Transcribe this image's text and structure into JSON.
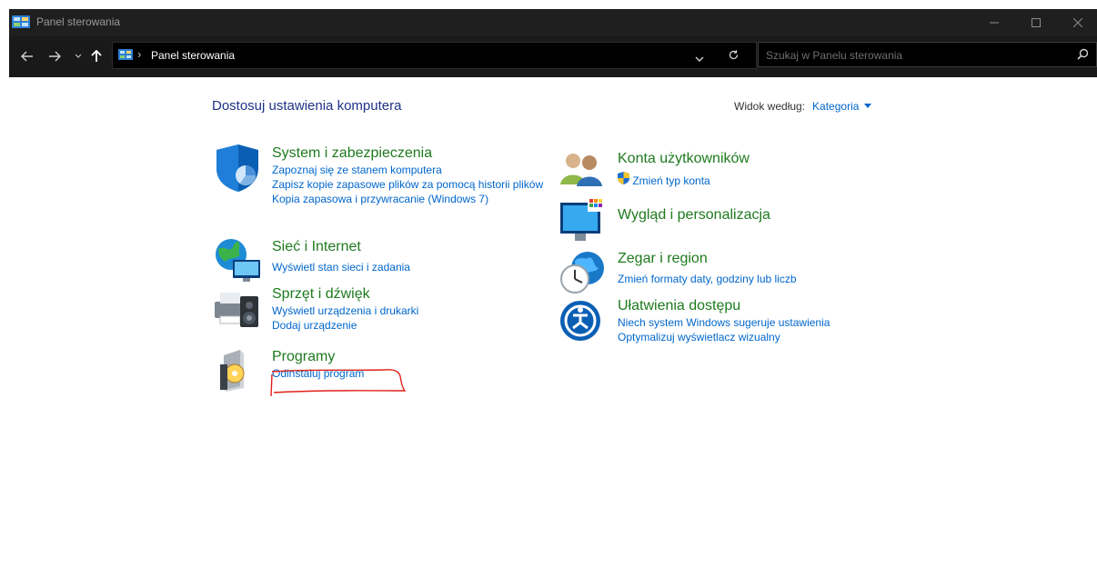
{
  "window": {
    "title": "Panel sterowania"
  },
  "address": {
    "crumb": "Panel sterowania",
    "search_placeholder": "Szukaj w Panelu sterowania"
  },
  "content": {
    "heading": "Dostosuj ustawienia komputera",
    "view_by_label": "Widok według:",
    "view_by_value": "Kategoria"
  },
  "categories": [
    {
      "title": "System i zabezpieczenia",
      "links": [
        "Zapoznaj się ze stanem komputera",
        "Zapisz kopie zapasowe plików za pomocą historii plików",
        "Kopia zapasowa i przywracanie (Windows 7)"
      ],
      "icon": "shield-icon"
    },
    {
      "title": "Sieć i Internet",
      "links": [
        "Wyświetl stan sieci i zadania"
      ],
      "icon": "network-globe-icon"
    },
    {
      "title": "Sprzęt i dźwięk",
      "links": [
        "Wyświetl urządzenia i drukarki",
        "Dodaj urządzenie"
      ],
      "icon": "printer-speaker-icon"
    },
    {
      "title": "Programy",
      "links": [
        "Odinstaluj program"
      ],
      "icon": "programs-disc-icon"
    },
    {
      "title": "Konta użytkowników",
      "links": [
        "Zmień typ konta"
      ],
      "icon": "users-icon"
    },
    {
      "title": "Wygląd i personalizacja",
      "links": [],
      "icon": "monitor-palette-icon"
    },
    {
      "title": "Zegar i region",
      "links": [
        "Zmień formaty daty, godziny lub liczb"
      ],
      "icon": "clock-globe-icon"
    },
    {
      "title": "Ułatwienia dostępu",
      "links": [
        "Niech system Windows sugeruje ustawienia",
        "Optymalizuj wyświetlacz wizualny"
      ],
      "icon": "accessibility-icon"
    }
  ],
  "colors": {
    "titlebar": "#1f1f1f",
    "addressbar": "#191919",
    "link": "#0066cc",
    "category_title": "#1e7a1e",
    "heading": "#1e3287",
    "annotation": "#e0201a"
  }
}
